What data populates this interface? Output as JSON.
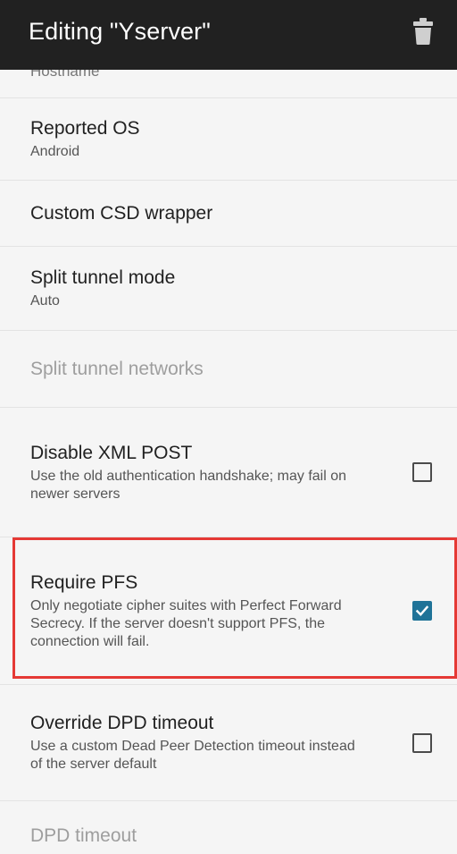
{
  "appbar": {
    "title": "Editing \"Yserver\"",
    "delete_icon": "trash-icon"
  },
  "settings": {
    "cut_item": "Hostname",
    "reported_os": {
      "title": "Reported OS",
      "summary": "Android"
    },
    "custom_csd": {
      "title": "Custom CSD wrapper"
    },
    "split_tunnel_mode": {
      "title": "Split tunnel mode",
      "summary": "Auto"
    },
    "split_tunnel_networks": {
      "title": "Split tunnel networks"
    },
    "disable_xml_post": {
      "title": "Disable XML POST",
      "summary": "Use the old authentication handshake; may fail on newer servers",
      "checked": false
    },
    "require_pfs": {
      "title": "Require PFS",
      "summary": "Only negotiate cipher suites with Perfect Forward Secrecy. If the server doesn't support PFS, the connection will fail.",
      "checked": true
    },
    "override_dpd": {
      "title": "Override DPD timeout",
      "summary": "Use a custom Dead Peer Detection timeout instead of the server default",
      "checked": false
    },
    "dpd_timeout": {
      "title": "DPD timeout"
    }
  },
  "colors": {
    "appbar_bg": "#212121",
    "accent": "#1f7398",
    "highlight": "#e53935",
    "background": "#f5f5f5"
  }
}
